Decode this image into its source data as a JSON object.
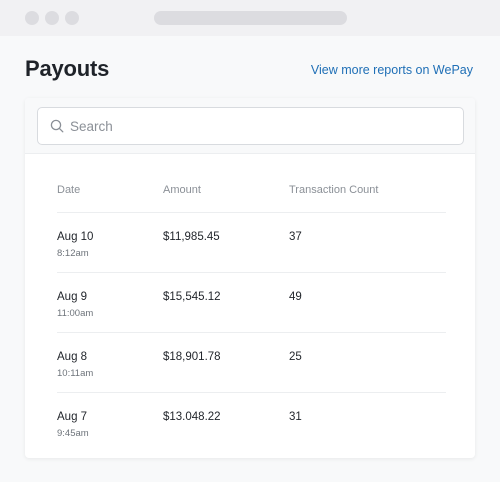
{
  "page": {
    "title": "Payouts",
    "reports_link": "View more reports on WePay"
  },
  "search": {
    "placeholder": "Search"
  },
  "table": {
    "columns": [
      "Date",
      "Amount",
      "Transaction Count"
    ],
    "rows": [
      {
        "date": "Aug 10",
        "time": "8:12am",
        "amount": "$11,985.45",
        "count": "37"
      },
      {
        "date": "Aug 9",
        "time": "11:00am",
        "amount": "$15,545.12",
        "count": "49"
      },
      {
        "date": "Aug 8",
        "time": "10:11am",
        "amount": "$18,901.78",
        "count": "25"
      },
      {
        "date": "Aug 7",
        "time": "9:45am",
        "amount": "$13.048.22",
        "count": "31"
      }
    ]
  },
  "colors": {
    "link": "#1f6fb6",
    "text": "#1f2329",
    "muted": "#8b9097",
    "border": "#d8dbdf"
  }
}
